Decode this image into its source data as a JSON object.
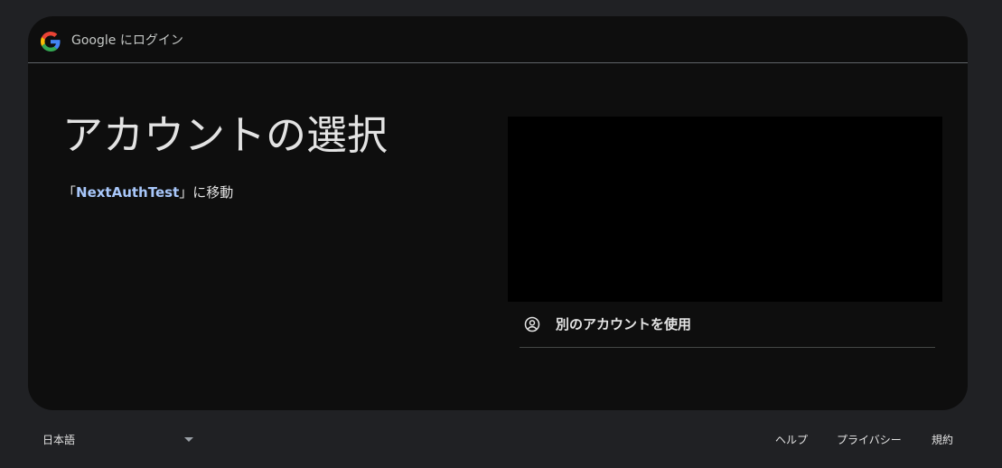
{
  "header": {
    "logo_icon": "google-g-logo",
    "title": "Google にログイン"
  },
  "main": {
    "title": "アカウントの選択",
    "subtitle_prefix": "「",
    "app_name": "NextAuthTest",
    "subtitle_suffix": "」に移動"
  },
  "accounts": {
    "use_other_label": "別のアカウントを使用",
    "use_other_icon": "account-circle-icon"
  },
  "footer": {
    "language": "日本語",
    "links": [
      "ヘルプ",
      "プライバシー",
      "規約"
    ]
  },
  "colors": {
    "background": "#202124",
    "card": "#0e0e0e",
    "link": "#a8c7fa",
    "text": "#e3e3e3"
  }
}
